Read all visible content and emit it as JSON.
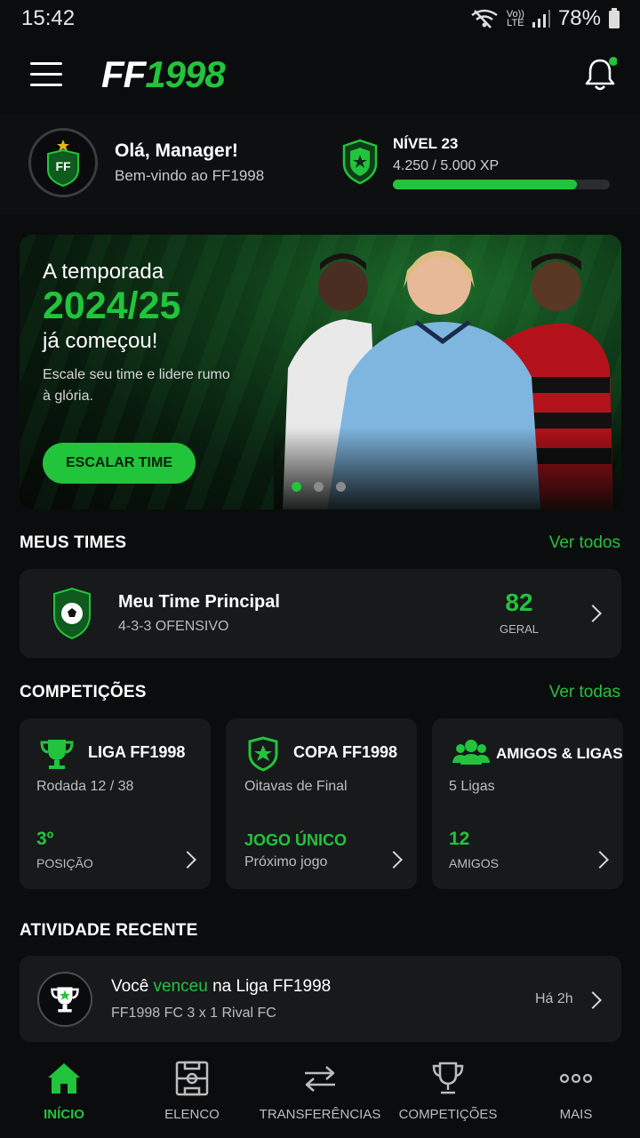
{
  "status_bar": {
    "time": "15:42",
    "network_top": "Vo))",
    "network_bottom": "LTE",
    "battery": "78%"
  },
  "header": {
    "logo_ff": "FF",
    "logo_num": "1998"
  },
  "profile": {
    "avatar_text": "FF",
    "greeting": "Olá, Manager!",
    "welcome": "Bem-vindo ao FF1998",
    "level": "NÍVEL 23",
    "xp": "4.250 / 5.000 XP",
    "xp_progress": 0.85
  },
  "hero": {
    "line1": "A temporada",
    "season": "2024/25",
    "line3": "já começou!",
    "subtitle": "Escale seu time e lidere rumo à glória.",
    "button": "ESCALAR TIME",
    "slide_count": 3,
    "active_slide": 1
  },
  "my_teams": {
    "title": "MEUS TIMES",
    "link": "Ver todos",
    "team": {
      "name": "Meu Time Principal",
      "formation": "4-3-3 OFENSIVO",
      "rating": "82",
      "rating_label": "GERAL"
    }
  },
  "competitions": {
    "title": "COMPETIÇÕES",
    "link": "Ver todas",
    "cards": [
      {
        "title": "LIGA FF1998",
        "subtitle": "Rodada 12 / 38",
        "value": "3º",
        "label": "POSIÇÃO",
        "icon": "trophy-icon"
      },
      {
        "title": "COPA FF1998",
        "subtitle": "Oitavas de Final",
        "value": "JOGO ÚNICO",
        "label": "Próximo jogo",
        "icon": "shield-star-icon"
      },
      {
        "title": "AMIGOS & LIGAS",
        "subtitle": "5 Ligas",
        "value": "12",
        "label": "AMIGOS",
        "icon": "friends-icon"
      }
    ]
  },
  "activity": {
    "title": "ATIVIDADE RECENTE",
    "item": {
      "prefix": "Você ",
      "highlight": "venceu",
      "suffix": " na Liga FF1998",
      "detail": "FF1998 FC 3 x 1 Rival FC",
      "time": "Há 2h"
    }
  },
  "bottom_nav": {
    "items": [
      {
        "label": "INÍCIO",
        "icon": "home-icon",
        "active": true
      },
      {
        "label": "ELENCO",
        "icon": "field-icon",
        "active": false
      },
      {
        "label": "TRANSFERÊNCIAS",
        "icon": "transfer-icon",
        "active": false
      },
      {
        "label": "COMPETIÇÕES",
        "icon": "trophy-icon",
        "active": false
      },
      {
        "label": "MAIS",
        "icon": "more-icon",
        "active": false
      }
    ]
  },
  "colors": {
    "accent": "#22c43c",
    "background": "#0b0c0d",
    "card": "#17191b"
  }
}
